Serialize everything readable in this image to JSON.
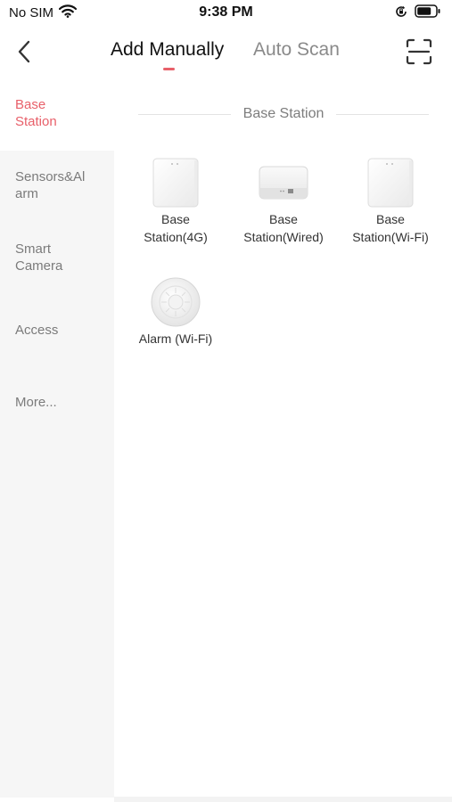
{
  "status_bar": {
    "carrier": "No SIM",
    "time": "9:38 PM"
  },
  "nav": {
    "tabs": [
      {
        "label": "Add Manually",
        "active": true
      },
      {
        "label": "Auto Scan",
        "active": false
      }
    ],
    "back_icon": "chevron-left-icon",
    "scan_icon": "scan-frame-icon"
  },
  "sidebar": {
    "items": [
      {
        "label": "Base\nStation",
        "active": true
      },
      {
        "label": "Sensors&Al\narm",
        "active": false
      },
      {
        "label": "Smart\nCamera",
        "active": false
      },
      {
        "label": "Access",
        "active": false
      },
      {
        "label": "More...",
        "active": false
      }
    ]
  },
  "section": {
    "title": "Base Station"
  },
  "devices": [
    {
      "label": "Base\nStation(4G)",
      "icon": "base-station-4g-icon"
    },
    {
      "label": "Base\nStation(Wired)",
      "icon": "base-station-wired-icon"
    },
    {
      "label": "Base\nStation(Wi-Fi)",
      "icon": "base-station-wifi-icon"
    },
    {
      "label": "Alarm (Wi-Fi)",
      "icon": "alarm-wifi-icon"
    }
  ],
  "colors": {
    "accent": "#e8606a",
    "sidebar_bg": "#f6f6f6",
    "inactive_text": "#7b7b7b"
  }
}
